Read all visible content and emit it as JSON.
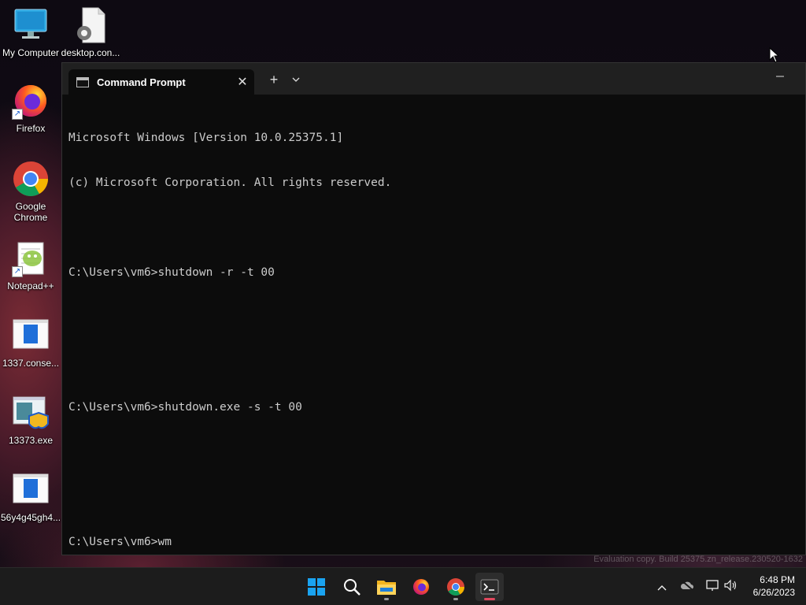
{
  "desktop": {
    "icons": [
      {
        "label": "My Computer",
        "icon": "computer-icon"
      },
      {
        "label": "desktop.con...",
        "icon": "settings-file-icon"
      },
      {
        "label": "Firefox",
        "icon": "firefox-icon"
      },
      {
        "label": "Google Chrome",
        "icon": "chrome-icon"
      },
      {
        "label": "Notepad++",
        "icon": "notepadpp-icon"
      },
      {
        "label": "1337.conse...",
        "icon": "app-window-icon"
      },
      {
        "label": "13373.exe",
        "icon": "installer-icon"
      },
      {
        "label": "56y4g45gh4...",
        "icon": "app-window-icon"
      }
    ],
    "watermark": "Evaluation copy. Build 25375.zn_release.230520-1632"
  },
  "terminal": {
    "tab_title": "Command Prompt",
    "close_glyph": "✕",
    "new_tab_glyph": "+",
    "dropdown_glyph": "⌄",
    "minimize_glyph": "—",
    "lines": [
      "Microsoft Windows [Version 10.0.25375.1]",
      "(c) Microsoft Corporation. All rights reserved.",
      "",
      "C:\\Users\\vm6>shutdown -r -t 00",
      "",
      "",
      "C:\\Users\\vm6>shutdown.exe -s -t 00",
      "",
      "",
      "C:\\Users\\vm6>wm"
    ]
  },
  "taskbar": {
    "items": [
      {
        "name": "start-button",
        "icon": "windows-logo-icon"
      },
      {
        "name": "search-button",
        "icon": "search-icon"
      },
      {
        "name": "file-explorer-button",
        "icon": "folder-icon"
      },
      {
        "name": "firefox-taskbar-button",
        "icon": "firefox-icon"
      },
      {
        "name": "chrome-taskbar-button",
        "icon": "chrome-icon"
      },
      {
        "name": "terminal-taskbar-button",
        "icon": "terminal-icon"
      }
    ],
    "tray": {
      "chevron_glyph": "^",
      "time": "6:48 PM",
      "date": "6/26/2023"
    }
  },
  "colors": {
    "console_text": "#cccccc",
    "console_bg": "#0c0c0c",
    "titlebar_bg": "#202020",
    "taskbar_bg": "#1c1c1c",
    "active_indicator": "#e0485e"
  }
}
